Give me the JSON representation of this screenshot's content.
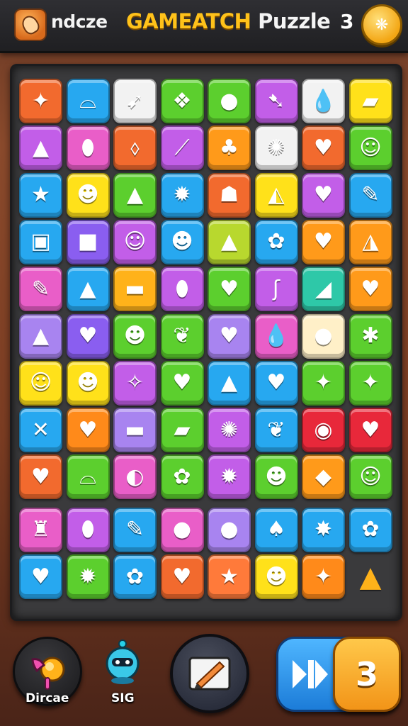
{
  "header": {
    "app_name": "ndcze",
    "title_part1": "GAMEATCH",
    "title_part2": "Puzzle",
    "counter": "3",
    "coin_glyph": "❋"
  },
  "board": {
    "rows": [
      [
        {
          "c": "#f26a2e",
          "g": "✦"
        },
        {
          "c": "#27a8f0",
          "g": "⌓"
        },
        {
          "c": "#f2f2f2",
          "g": "➹"
        },
        {
          "c": "#5ccf2e",
          "g": "❖"
        },
        {
          "c": "#5ccf2e",
          "g": "●"
        },
        {
          "c": "#c25ee8",
          "g": "➷"
        },
        {
          "c": "#f2f2f2",
          "g": "💧"
        },
        {
          "c": "#ffe11a",
          "g": "▰"
        }
      ],
      [
        {
          "c": "#c25ee8",
          "g": "▲"
        },
        {
          "c": "#e95ec8",
          "g": "⬮"
        },
        {
          "c": "#f26a2e",
          "g": "⬨"
        },
        {
          "c": "#c25ee8",
          "g": "⟋"
        },
        {
          "c": "#ff9a1a",
          "g": "♣"
        },
        {
          "c": "#f2f2f2",
          "g": "✺"
        },
        {
          "c": "#f26a2e",
          "g": "♥"
        },
        {
          "c": "#5ccf2e",
          "g": "☺"
        }
      ],
      [
        {
          "c": "#27a8f0",
          "g": "★"
        },
        {
          "c": "#ffe11a",
          "g": "☻"
        },
        {
          "c": "#5ccf2e",
          "g": "▲"
        },
        {
          "c": "#27a8f0",
          "g": "✹"
        },
        {
          "c": "#f26a2e",
          "g": "☗"
        },
        {
          "c": "#ffe11a",
          "g": "◭"
        },
        {
          "c": "#c25ee8",
          "g": "♥"
        },
        {
          "c": "#27a8f0",
          "g": "✎"
        }
      ],
      [
        {
          "c": "#27a8f0",
          "g": "▣"
        },
        {
          "c": "#8a5ef0",
          "g": "■"
        },
        {
          "c": "#c25ee8",
          "g": "☺"
        },
        {
          "c": "#27a8f0",
          "g": "☻"
        },
        {
          "c": "#b8d82e",
          "g": "▲"
        },
        {
          "c": "#27a8f0",
          "g": "✿"
        },
        {
          "c": "#ff9a1a",
          "g": "♥"
        },
        {
          "c": "#ff9a1a",
          "g": "◮"
        }
      ],
      [
        {
          "c": "#e95ec8",
          "g": "✎"
        },
        {
          "c": "#27a8f0",
          "g": "▲"
        },
        {
          "c": "#ffb21a",
          "g": "▬"
        },
        {
          "c": "#c25ee8",
          "g": "⬮"
        },
        {
          "c": "#5ccf2e",
          "g": "♥"
        },
        {
          "c": "#c25ee8",
          "g": "ʃ"
        },
        {
          "c": "#2ec8a8",
          "g": "◢"
        },
        {
          "c": "#ff9a1a",
          "g": "♥"
        }
      ],
      [
        {
          "c": "#a884f0",
          "g": "▲"
        },
        {
          "c": "#8a5ef0",
          "g": "♥"
        },
        {
          "c": "#5ccf2e",
          "g": "☻"
        },
        {
          "c": "#5ccf2e",
          "g": "❦"
        },
        {
          "c": "#a884f0",
          "g": "♥"
        },
        {
          "c": "#e95ec8",
          "g": "💧"
        },
        {
          "c": "#fff0c8",
          "g": "●"
        },
        {
          "c": "#5ccf2e",
          "g": "✱"
        }
      ],
      [
        {
          "c": "#ffe11a",
          "g": "☺"
        },
        {
          "c": "#ffe11a",
          "g": "☻"
        },
        {
          "c": "#c25ee8",
          "g": "✧"
        },
        {
          "c": "#5ccf2e",
          "g": "♥"
        },
        {
          "c": "#27a8f0",
          "g": "▲"
        },
        {
          "c": "#27a8f0",
          "g": "♥"
        },
        {
          "c": "#5ccf2e",
          "g": "✦"
        },
        {
          "c": "#5ccf2e",
          "g": "✦"
        }
      ],
      [
        {
          "c": "#27a8f0",
          "g": "✕"
        },
        {
          "c": "#ff8a1a",
          "g": "♥"
        },
        {
          "c": "#a884f0",
          "g": "▬"
        },
        {
          "c": "#5ccf2e",
          "g": "▰"
        },
        {
          "c": "#c25ee8",
          "g": "✺"
        },
        {
          "c": "#27a8f0",
          "g": "❦"
        },
        {
          "c": "#e8283a",
          "g": "◉"
        },
        {
          "c": "#e8283a",
          "g": "♥"
        }
      ],
      [
        {
          "c": "#f26a2e",
          "g": "♥"
        },
        {
          "c": "#5ccf2e",
          "g": "⌓"
        },
        {
          "c": "#e95ec8",
          "g": "◐"
        },
        {
          "c": "#5ccf2e",
          "g": "✿"
        },
        {
          "c": "#c25ee8",
          "g": "✹"
        },
        {
          "c": "#5ccf2e",
          "g": "☻"
        },
        {
          "c": "#ff9a1a",
          "g": "◆"
        },
        {
          "c": "#5ccf2e",
          "g": "☺"
        }
      ],
      [
        {
          "c": "#e95ec8",
          "g": "♜"
        },
        {
          "c": "#c25ee8",
          "g": "⬮"
        },
        {
          "c": "#27a8f0",
          "g": "✎"
        },
        {
          "c": "#e95ec8",
          "g": "●"
        },
        {
          "c": "#a884f0",
          "g": "●"
        },
        {
          "c": "#27a8f0",
          "g": "♠"
        },
        {
          "c": "#27a8f0",
          "g": "✸"
        },
        {
          "c": "#27a8f0",
          "g": "✿"
        }
      ],
      [
        {
          "c": "#27a8f0",
          "g": "♥"
        },
        {
          "c": "#5ccf2e",
          "g": "✹"
        },
        {
          "c": "#27a8f0",
          "g": "✿"
        },
        {
          "c": "#f26a2e",
          "g": "♥"
        },
        {
          "c": "#ff7a3a",
          "g": "★"
        },
        {
          "c": "#ffe11a",
          "g": "☻"
        },
        {
          "c": "#ff8a1a",
          "g": "✦"
        },
        {
          "c": "",
          "g": "▲"
        }
      ]
    ]
  },
  "controls": {
    "left_label": "Dircae",
    "second_label": "SIG",
    "moves_value": "3"
  },
  "colors": {
    "accent": "#ffc21a",
    "board": "#3a3a3c",
    "pill": "#1c7cd8"
  }
}
